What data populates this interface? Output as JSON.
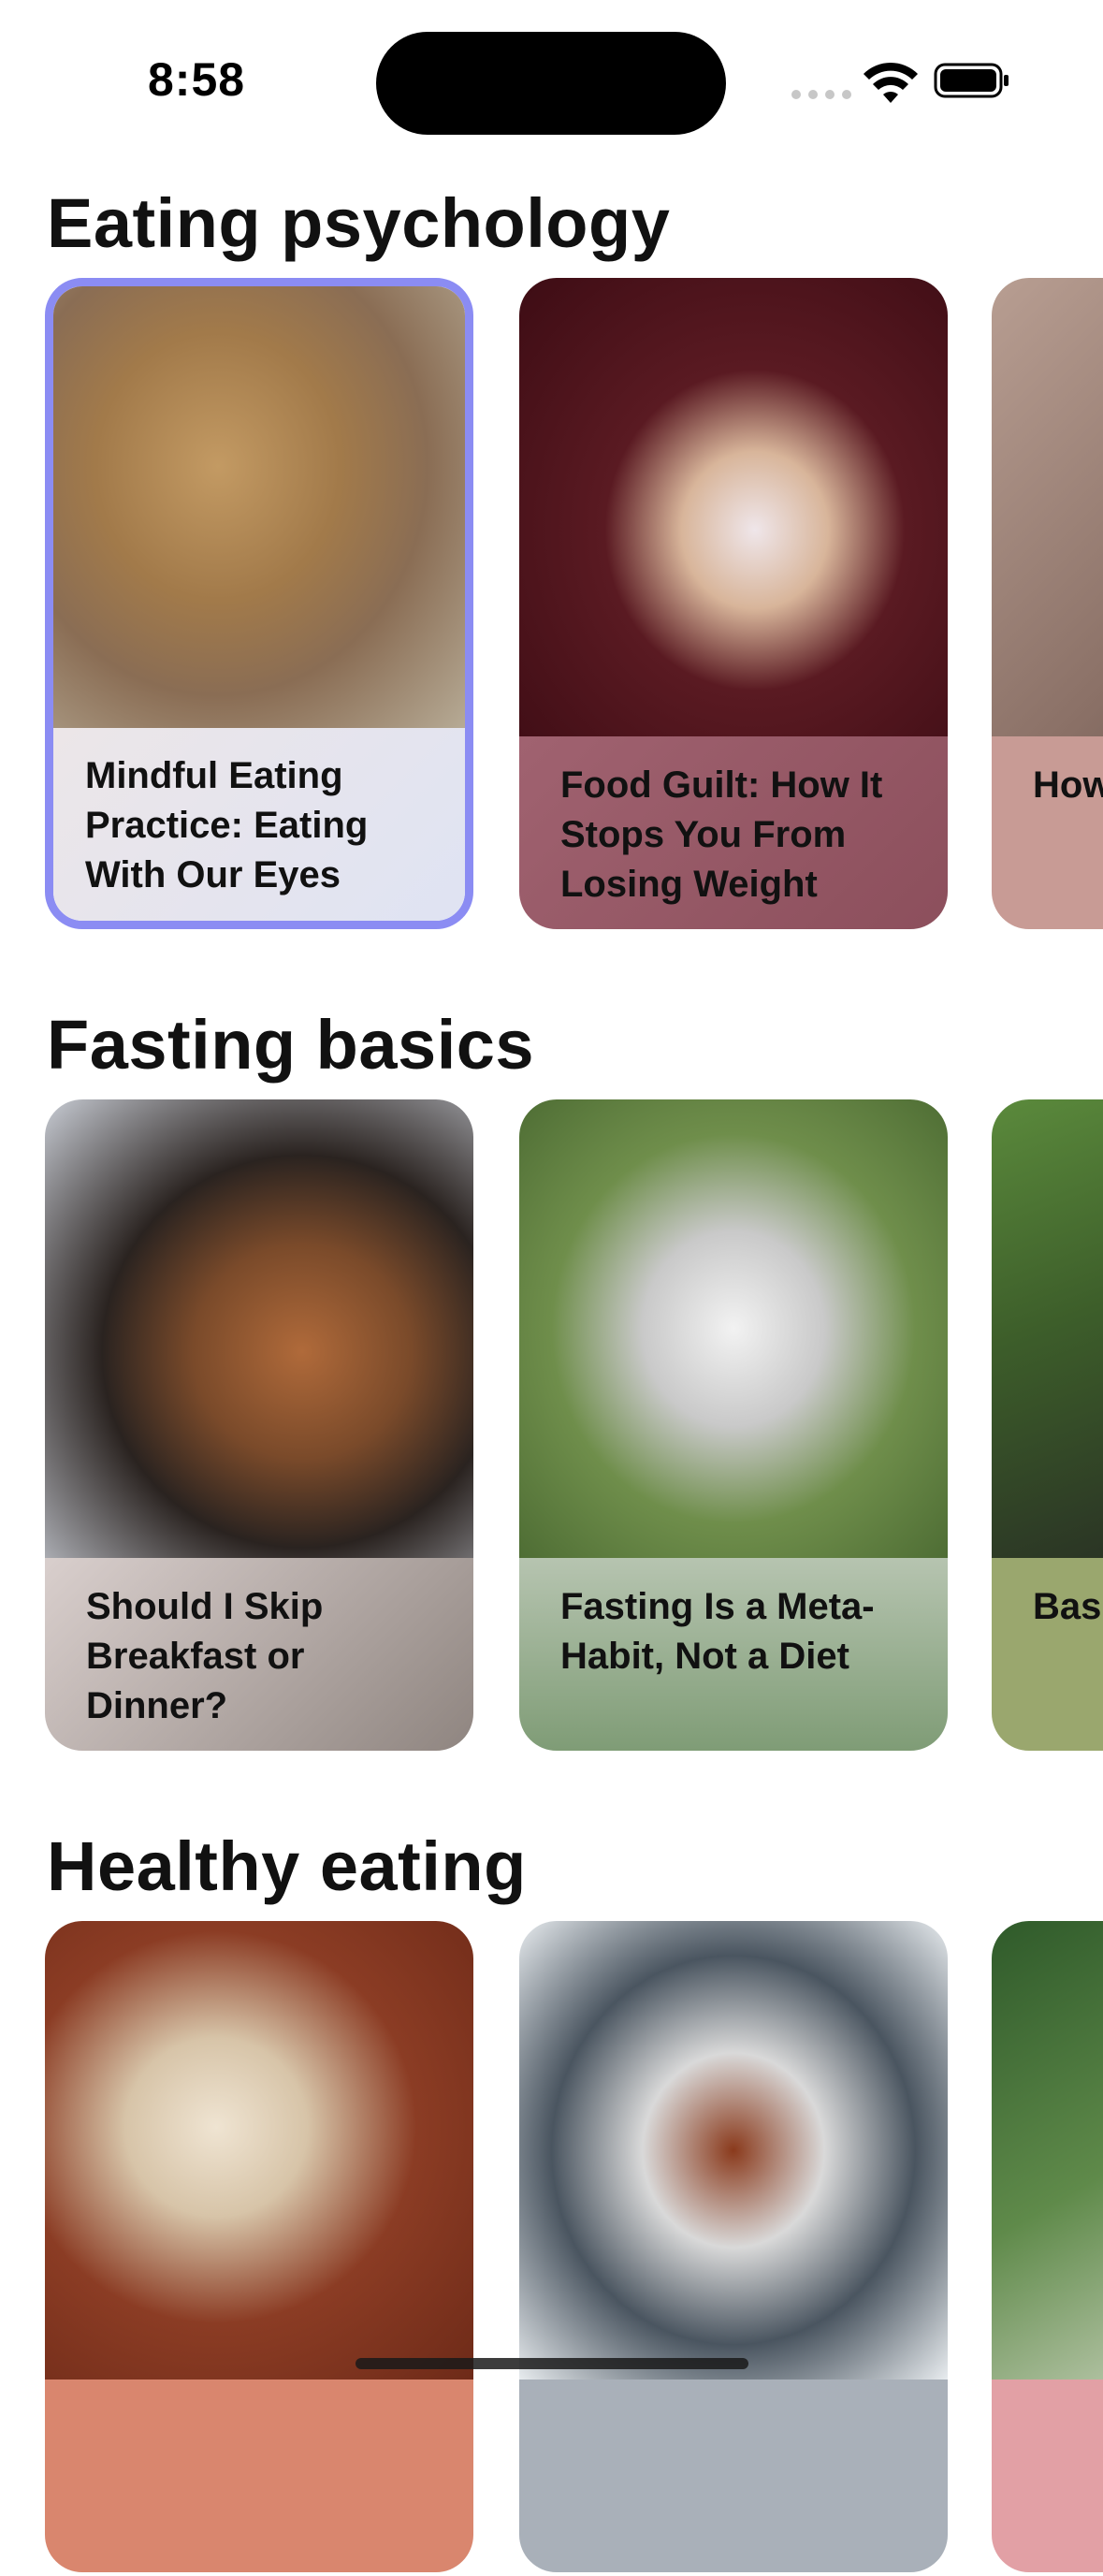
{
  "status_bar": {
    "time": "8:58",
    "icons": [
      "cellular-signal-icon",
      "wifi-icon",
      "battery-icon"
    ]
  },
  "sections": [
    {
      "title": "Eating psychology",
      "cards": [
        {
          "title": "Mindful Eating Practice: Eating With Our Eyes",
          "image": "terrier-with-piggy-bank-photo",
          "selected": true
        },
        {
          "title": "Food Guilt: How It Stops You From Losing Weight",
          "image": "chihuahua-on-red-couch-photo"
        },
        {
          "title": "How aÂ Rela",
          "image": "dog-on-brown-floor-photo"
        }
      ]
    },
    {
      "title": "Fasting basics",
      "cards": [
        {
          "title": "Should I Skip Breakfast or Dinner?",
          "image": "beagle-closeup-photo"
        },
        {
          "title": "Fasting Is a Meta-Habit, Not a Diet",
          "image": "saluki-puppy-on-grass-photo"
        },
        {
          "title": "Bas Inte Fas",
          "image": "dog-in-garden-photo"
        }
      ]
    },
    {
      "title": "Healthy eating",
      "cards": [
        {
          "title": "",
          "image": "pitbull-on-wood-floor-photo"
        },
        {
          "title": "",
          "image": "boxer-puppy-in-snow-photo"
        },
        {
          "title": "",
          "image": "white-fluffy-dog-photo"
        }
      ]
    }
  ],
  "colors": {
    "selected_border": "#8b8cf3",
    "background": "#ffffff"
  }
}
